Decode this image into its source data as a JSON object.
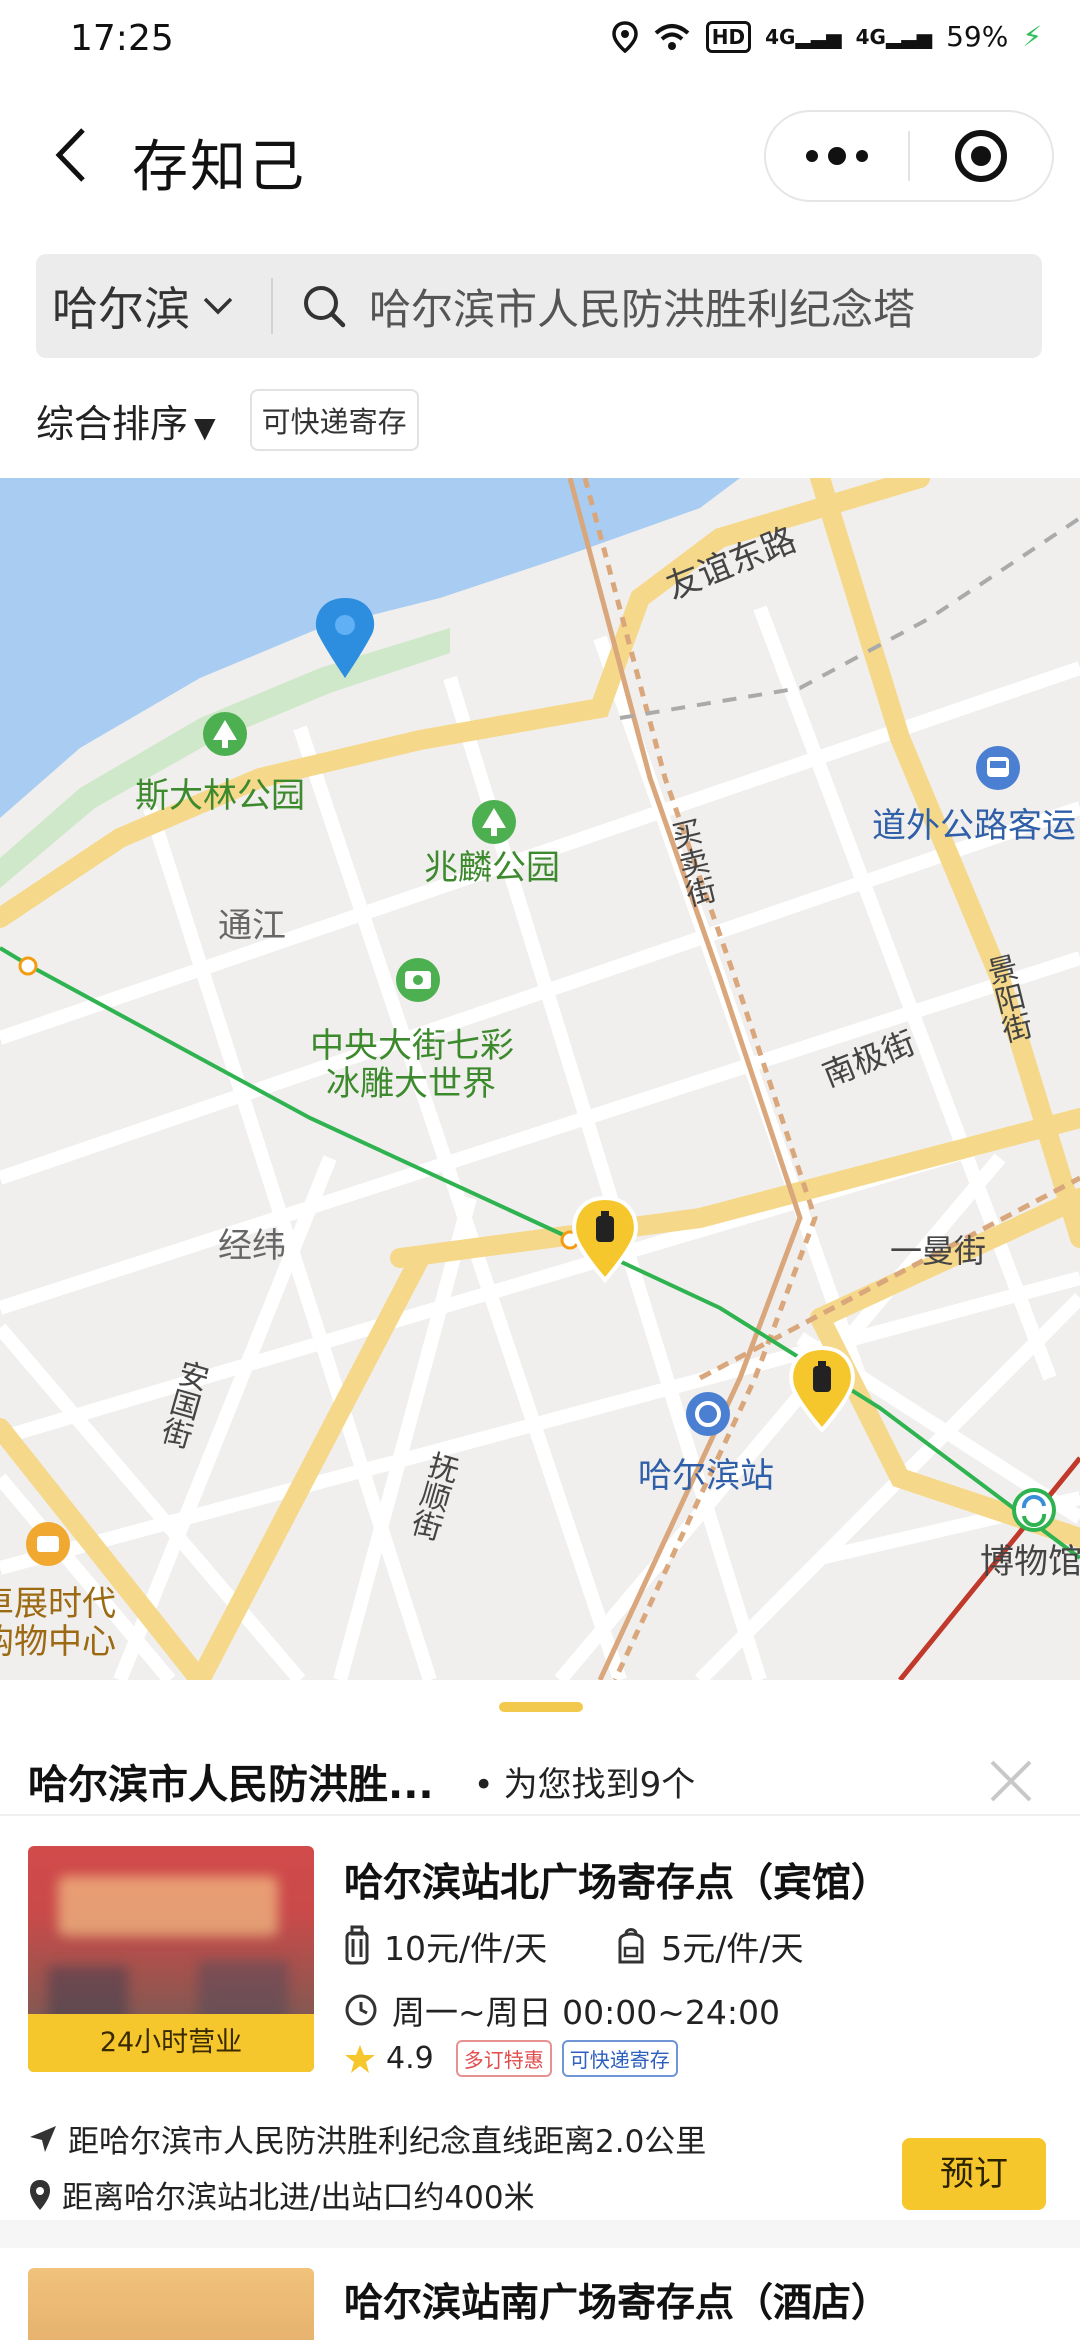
{
  "status_bar": {
    "time": "17:25",
    "hd_label": "HD",
    "network_1": "4G",
    "network_2": "4G",
    "battery": "59%"
  },
  "nav": {
    "title": "存知己"
  },
  "search": {
    "city": "哈尔滨",
    "query": "哈尔滨市人民防洪胜利纪念塔"
  },
  "filters": {
    "sort_label": "综合排序",
    "sort_arrow": "▼",
    "chip_express": "可快递寄存"
  },
  "map": {
    "labels": {
      "youyi_road": "友谊东路",
      "stalin_park": "斯大林公园",
      "zhaolin_park": "兆麟公园",
      "tongjiang": "通江",
      "ice_world_1": "中央大街七彩",
      "ice_world_2": "冰雕大世界",
      "maimai_street": "买卖街",
      "daowai_bus": "道外公路客运",
      "jingyang_street": "景阳街",
      "nanji_street": "南极街",
      "jingwei": "经纬",
      "yiman_street": "一曼街",
      "anguo_street": "安国街",
      "fushun_street": "抚顺街",
      "harbin_station": "哈尔滨站",
      "museum": "博物馆",
      "mall_1": "卓展时代",
      "mall_2": "购物中心"
    },
    "colors": {
      "water": "#a9cdf2",
      "road_major": "#f7d98a",
      "park": "#cfe8c9",
      "metro_line": "#2fb350",
      "pin_blue": "#2d8ee0",
      "marker_yellow": "#f5c72d"
    }
  },
  "sheet": {
    "title": "哈尔滨市人民防洪胜...",
    "count_text": "为您找到9个",
    "dot": "•"
  },
  "stores": [
    {
      "name": "哈尔滨站北广场寄存点（宾馆）",
      "badge": "24小时营业",
      "price_luggage": "10元/件/天",
      "price_bag": "5元/件/天",
      "hours": "周一~周日 00:00~24:00",
      "rating": "4.9",
      "tag_discount": "多订特惠",
      "tag_express": "可快递寄存",
      "distance_landmark": "距哈尔滨市人民防洪胜利纪念直线距离2.0公里",
      "distance_exit": "距离哈尔滨站北进/出站口约400米",
      "book_label": "预订"
    },
    {
      "name": "哈尔滨站南广场寄存点（酒店）"
    }
  ]
}
